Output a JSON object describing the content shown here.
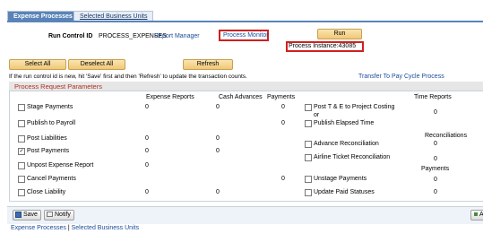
{
  "tabs": [
    {
      "label": "Expense Processes"
    },
    {
      "label": "Selected Business Units"
    }
  ],
  "run_control": {
    "label": "Run Control ID",
    "value": "PROCESS_EXPENSES",
    "report_manager": "Report Manager",
    "process_monitor": "Process Monitor",
    "run_button": "Run",
    "process_instance": "Process Instance:43085"
  },
  "buttons": {
    "select_all": "Select All",
    "deselect_all": "Deselect All",
    "refresh": "Refresh"
  },
  "info_text": "If the run control id is new, hit 'Save' first and then 'Refresh' to update the transaction counts.",
  "transfer_link": "Transfer To Pay Cycle Process",
  "panel": {
    "title": "Process Request Parameters",
    "col_expense_reports": "Expense Reports",
    "col_cash_advances": "Cash Advances",
    "col_payments": "Payments",
    "col_time_reports": "Time Reports",
    "col_reconciliations": "Reconciliations",
    "col_payments_right": "Payments"
  },
  "left_rows": [
    {
      "label": "Stage Payments",
      "checked": false,
      "expense": "0",
      "cash": "0",
      "payments": "0"
    },
    {
      "label": "Publish to Payroll",
      "checked": false,
      "expense": "",
      "cash": "",
      "payments": "0"
    },
    {
      "label": "Post Liabilities",
      "checked": false,
      "expense": "0",
      "cash": "0",
      "payments": ""
    },
    {
      "label": "Post Payments",
      "checked": true,
      "expense": "0",
      "cash": "0",
      "payments": ""
    },
    {
      "label": "Unpost Expense Report",
      "checked": false,
      "expense": "0",
      "cash": "",
      "payments": ""
    },
    {
      "label": "Cancel Payments",
      "checked": false,
      "expense": "",
      "cash": "",
      "payments": "0"
    },
    {
      "label": "Close Liability",
      "checked": false,
      "expense": "0",
      "cash": "0",
      "payments": ""
    }
  ],
  "right_rows": {
    "post_te_line1": "Post T & E to Project Costing",
    "post_te_line2": "or",
    "post_te_value": "0",
    "publish_elapsed": "Publish Elapsed Time",
    "advance_recon": "Advance Reconciliation",
    "advance_recon_value": "0",
    "airline_recon": "Airline Ticket Reconciliation",
    "airline_recon_value": "0",
    "unstage_payments": "Unstage Payments",
    "unstage_payments_value": "0",
    "update_paid": "Update Paid Statuses",
    "update_paid_value": "0"
  },
  "bottom": {
    "save": "Save",
    "notify": "Notify",
    "edge_label": "A"
  },
  "footer": {
    "link1": "Expense Processes",
    "separator": " | ",
    "link2": "Selected Business Units"
  },
  "colors": {
    "tab_active": "#5a84b8",
    "highlight_red": "#d02020",
    "link_blue": "#1a4a9a",
    "panel_title": "#b03020"
  }
}
